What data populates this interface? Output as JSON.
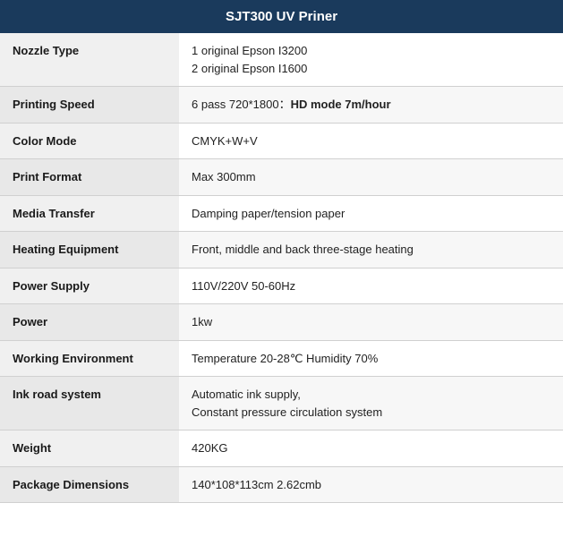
{
  "header": {
    "title": "SJT300 UV Priner"
  },
  "rows": [
    {
      "label": "Nozzle Type",
      "value": "1 original Epson I3200\n2 original Epson I1600",
      "bold_part": null
    },
    {
      "label": "Printing Speed",
      "value_prefix": "6 pass 720*1800：",
      "value_bold": "HD mode 7m/hour",
      "value": null
    },
    {
      "label": "Color Mode",
      "value": "CMYK+W+V",
      "bold_part": null
    },
    {
      "label": "Print Format",
      "value": "Max 300mm",
      "bold_part": null
    },
    {
      "label": "Media Transfer",
      "value": "Damping paper/tension paper",
      "bold_part": null
    },
    {
      "label": "Heating Equipment",
      "value": "Front, middle and back three-stage heating",
      "bold_part": null
    },
    {
      "label": "Power Supply",
      "value": "110V/220V 50-60Hz",
      "bold_part": null
    },
    {
      "label": "Power",
      "value": "1kw",
      "bold_part": null
    },
    {
      "label": "Working Environment",
      "value": "Temperature 20-28℃ Humidity 70%",
      "bold_part": null
    },
    {
      "label": "Ink road system",
      "value": "Automatic ink supply,\nConstant pressure circulation system",
      "bold_part": null
    },
    {
      "label": "Weight",
      "value": "420KG",
      "bold_part": null
    },
    {
      "label": "Package Dimensions",
      "value": "140*108*113cm 2.62cmb",
      "bold_part": null
    }
  ]
}
